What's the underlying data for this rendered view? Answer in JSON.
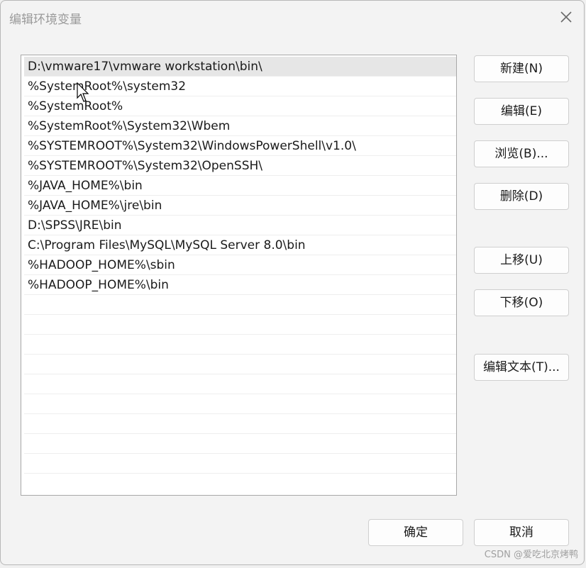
{
  "window": {
    "title": "编辑环境变量",
    "close_icon": "close-icon"
  },
  "path_list": {
    "items": [
      "D:\\vmware17\\vmware workstation\\bin\\",
      "%SystemRoot%\\system32",
      "%SystemRoot%",
      "%SystemRoot%\\System32\\Wbem",
      "%SYSTEMROOT%\\System32\\WindowsPowerShell\\v1.0\\",
      "%SYSTEMROOT%\\System32\\OpenSSH\\",
      "%JAVA_HOME%\\bin",
      "%JAVA_HOME%\\jre\\bin",
      "D:\\SPSS\\JRE\\bin",
      "C:\\Program Files\\MySQL\\MySQL Server 8.0\\bin",
      "%HADOOP_HOME%\\sbin",
      "%HADOOP_HOME%\\bin"
    ],
    "selected_index": 0
  },
  "buttons": {
    "new": "新建(N)",
    "edit": "编辑(E)",
    "browse": "浏览(B)...",
    "delete": "删除(D)",
    "move_up": "上移(U)",
    "move_down": "下移(O)",
    "edit_text": "编辑文本(T)...",
    "ok": "确定",
    "cancel": "取消"
  },
  "watermark": "CSDN @爱吃北京烤鸭"
}
